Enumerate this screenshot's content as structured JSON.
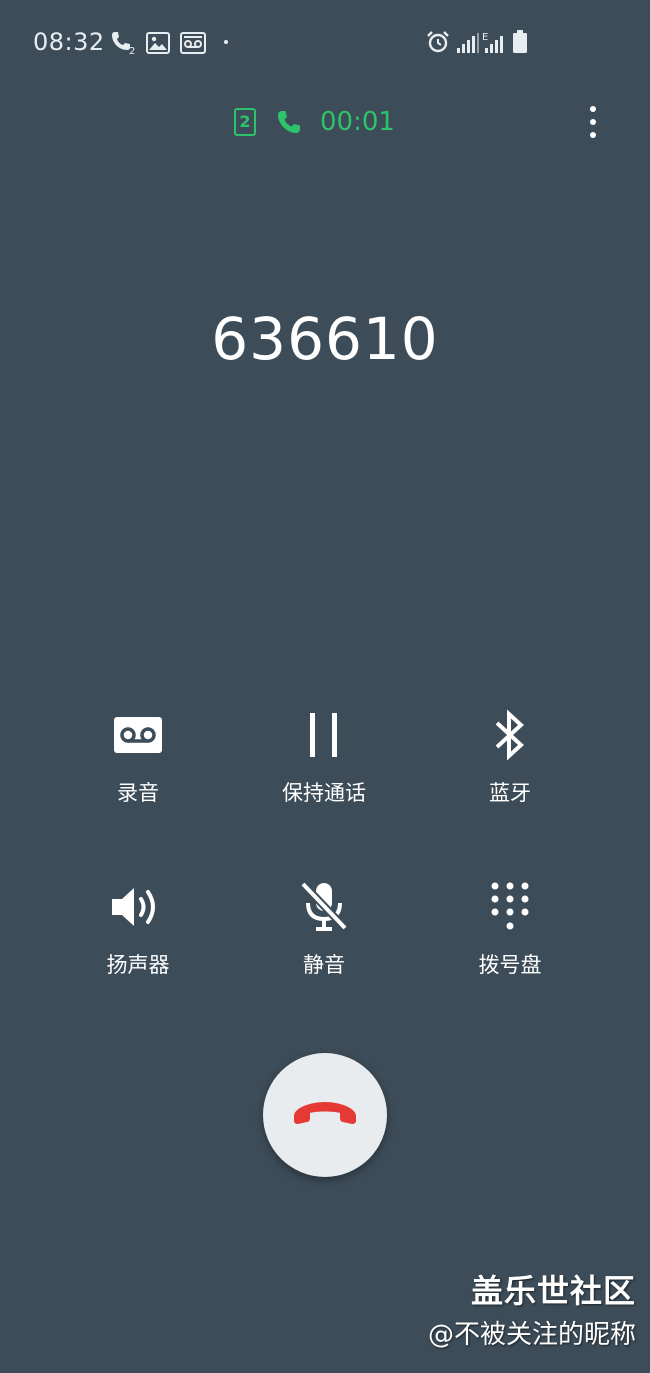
{
  "status_bar": {
    "time": "08:32",
    "left_icons": [
      "call-sim2-icon",
      "gallery-icon",
      "voicemail-icon"
    ],
    "right_icons": [
      "alarm-icon",
      "signal-icon",
      "signal-e-icon",
      "battery-icon"
    ],
    "network_label": "E"
  },
  "call_header": {
    "sim_label": "2",
    "duration": "00:01",
    "accent_color": "#2cc36b"
  },
  "call": {
    "number": "636610"
  },
  "controls": [
    {
      "label": "录音",
      "icon": "record-icon"
    },
    {
      "label": "保持通话",
      "icon": "pause-icon"
    },
    {
      "label": "蓝牙",
      "icon": "bluetooth-icon"
    },
    {
      "label": "扬声器",
      "icon": "speaker-icon"
    },
    {
      "label": "静音",
      "icon": "mic-off-icon"
    },
    {
      "label": "拨号盘",
      "icon": "dialpad-icon"
    }
  ],
  "end_call": {
    "icon": "end-call-icon",
    "color": "#e53935"
  },
  "watermark": {
    "title": "盖乐世社区",
    "user": "@不被关注的昵称"
  },
  "colors": {
    "background": "#3c4c58"
  }
}
